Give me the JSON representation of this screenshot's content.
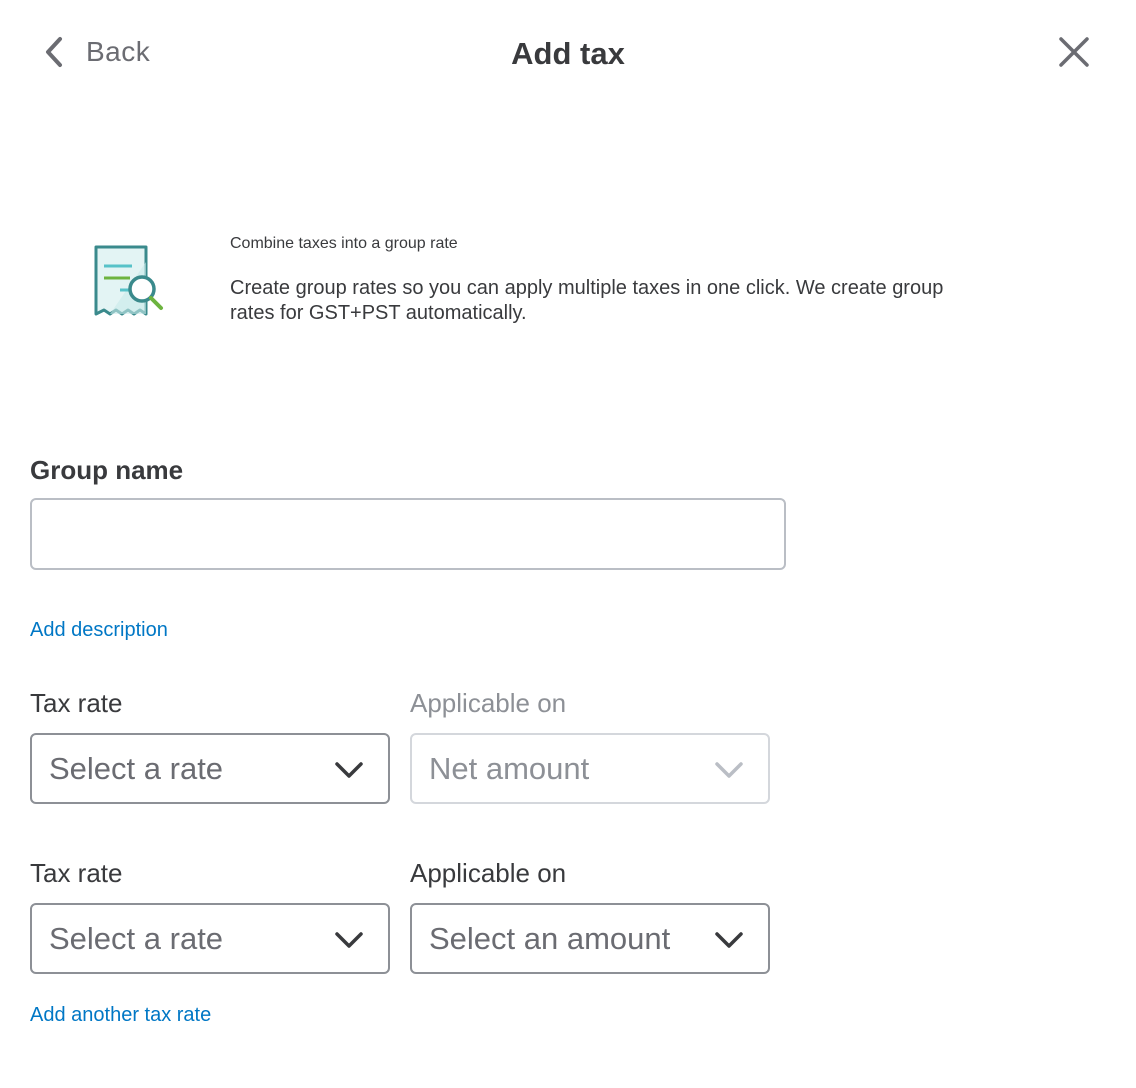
{
  "header": {
    "back_label": "Back",
    "title": "Add tax",
    "close_icon": "close-icon",
    "back_icon": "chevron-left-icon"
  },
  "info": {
    "icon": "receipt-magnifier-icon",
    "title": "Combine taxes into a group rate",
    "body": "Create group rates so you can apply multiple taxes in one click. We create group rates for GST+PST automatically."
  },
  "form": {
    "group_name_label": "Group name",
    "group_name_value": "",
    "add_description": "Add description",
    "rows": [
      {
        "tax_rate_label": "Tax rate",
        "tax_rate_value": "Select a rate",
        "applicable_label": "Applicable on",
        "applicable_value": "Net amount",
        "applicable_disabled": true
      },
      {
        "tax_rate_label": "Tax rate",
        "tax_rate_value": "Select a rate",
        "applicable_label": "Applicable on",
        "applicable_value": "Select an amount",
        "applicable_disabled": false
      }
    ],
    "add_another": "Add another tax rate"
  },
  "colors": {
    "link": "#0077c5",
    "text": "#393a3d",
    "icon_teal": "#3a8a8c",
    "icon_green": "#6db33f"
  }
}
